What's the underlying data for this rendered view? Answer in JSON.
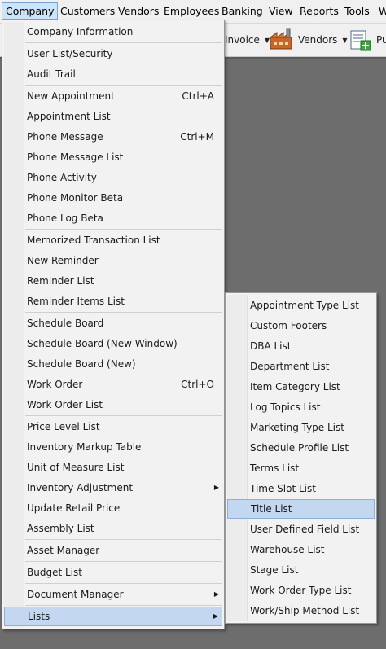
{
  "menubar": {
    "items": [
      {
        "label": "Company"
      },
      {
        "label": "Customers"
      },
      {
        "label": "Vendors"
      },
      {
        "label": "Employees"
      },
      {
        "label": "Banking"
      },
      {
        "label": "View"
      },
      {
        "label": "Reports"
      },
      {
        "label": "Tools"
      },
      {
        "label": "W"
      }
    ]
  },
  "toolbar": {
    "invoice_label": "Invoice",
    "vendors_label": "Vendors",
    "purchase_label": "Pu"
  },
  "company_menu": {
    "items": [
      {
        "label": "Company Information"
      },
      {
        "label": "User List/Security"
      },
      {
        "label": "Audit Trail"
      },
      {
        "label": "New Appointment",
        "shortcut": "Ctrl+A"
      },
      {
        "label": "Appointment List"
      },
      {
        "label": "Phone Message",
        "shortcut": "Ctrl+M"
      },
      {
        "label": "Phone Message List"
      },
      {
        "label": "Phone Activity"
      },
      {
        "label": "Phone Monitor Beta"
      },
      {
        "label": "Phone Log Beta"
      },
      {
        "label": "Memorized Transaction List"
      },
      {
        "label": "New Reminder"
      },
      {
        "label": "Reminder List"
      },
      {
        "label": "Reminder Items List"
      },
      {
        "label": "Schedule Board"
      },
      {
        "label": "Schedule Board (New Window)"
      },
      {
        "label": "Schedule Board (New)"
      },
      {
        "label": "Work Order",
        "shortcut": "Ctrl+O"
      },
      {
        "label": "Work Order List"
      },
      {
        "label": "Price Level List"
      },
      {
        "label": "Inventory Markup Table"
      },
      {
        "label": "Unit of Measure List"
      },
      {
        "label": "Inventory Adjustment"
      },
      {
        "label": "Update Retail Price"
      },
      {
        "label": "Assembly List"
      },
      {
        "label": "Asset Manager"
      },
      {
        "label": "Budget List"
      },
      {
        "label": "Document Manager"
      },
      {
        "label": "Lists"
      }
    ]
  },
  "lists_submenu": {
    "items": [
      {
        "label": "Appointment Type List"
      },
      {
        "label": "Custom Footers"
      },
      {
        "label": "DBA List"
      },
      {
        "label": "Department List"
      },
      {
        "label": "Item Category List"
      },
      {
        "label": "Log Topics List"
      },
      {
        "label": "Marketing Type List"
      },
      {
        "label": "Schedule Profile List"
      },
      {
        "label": "Terms List"
      },
      {
        "label": "Time Slot List"
      },
      {
        "label": "Title List"
      },
      {
        "label": "User Defined Field List"
      },
      {
        "label": "Warehouse List"
      },
      {
        "label": "Stage List"
      },
      {
        "label": "Work Order Type List"
      },
      {
        "label": "Work/Ship Method List"
      }
    ]
  },
  "submenu_arrow_icon": "triangle-right",
  "colors": {
    "menu_bg": "#f2f2f2",
    "highlight": "#c4d7f0",
    "workspace": "#6d6d6d"
  }
}
